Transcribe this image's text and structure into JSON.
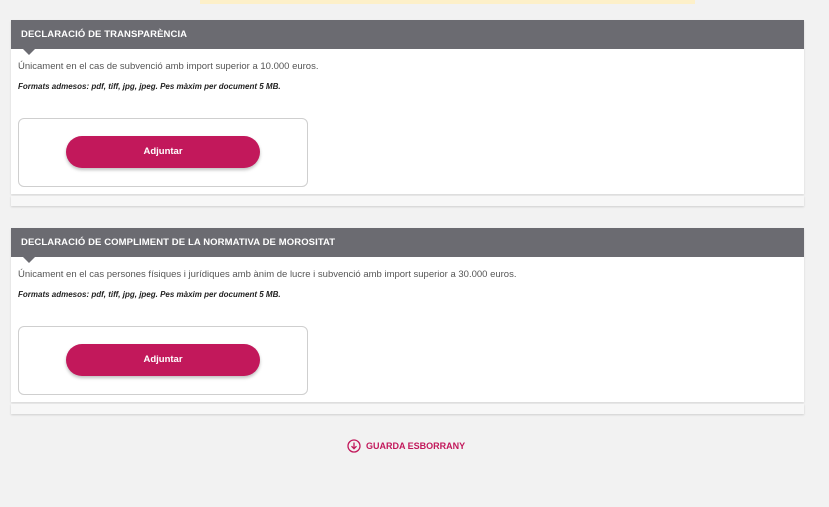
{
  "colors": {
    "accent": "#c2185b",
    "header_bg": "#6b6b71",
    "page_bg": "#f2f2f2"
  },
  "sections": [
    {
      "title": "DECLARACIÓ DE TRANSPARÈNCIA",
      "description": "Únicament en el cas de subvenció amb import superior a 10.000 euros.",
      "formats": "Formats admesos: pdf, tiff, jpg, jpeg. Pes màxim per document 5 MB.",
      "attach_label": "Adjuntar"
    },
    {
      "title": "DECLARACIÓ DE COMPLIMENT DE LA NORMATIVA DE MOROSITAT",
      "description": "Únicament en el cas persones físiques i jurídiques amb ànim de lucre i subvenció amb import superior a 30.000 euros.",
      "formats": "Formats admesos: pdf, tiff, jpg, jpeg. Pes màxim per document 5 MB.",
      "attach_label": "Adjuntar"
    }
  ],
  "save_draft": {
    "label": "GUARDA ESBORRANY",
    "icon": "download-circle-icon"
  }
}
